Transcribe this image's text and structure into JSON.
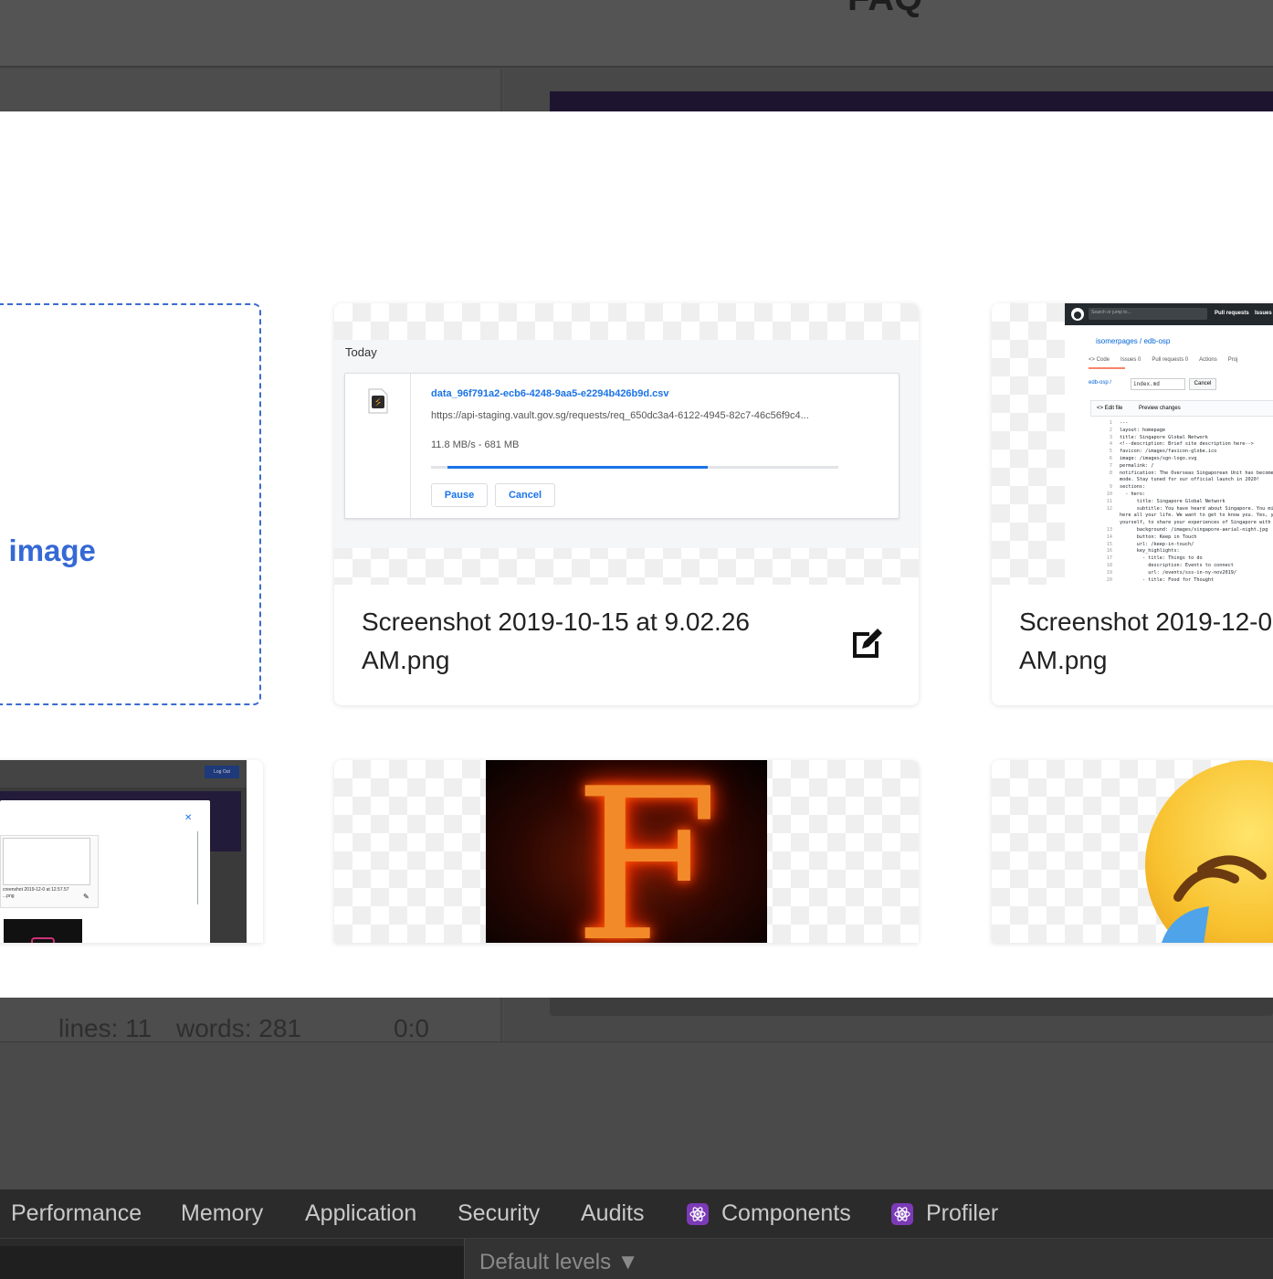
{
  "background_app": {
    "header_title": "FAQ",
    "status_bar": {
      "lines": "lines: 11",
      "words": "words: 281",
      "cursor": "0:0"
    }
  },
  "modal": {
    "upload": {
      "label": "v image"
    },
    "images": [
      {
        "filename": "Screenshot 2019-10-15 at 9.02.26 AM.png",
        "icon": "edit-icon",
        "preview": {
          "heading": "Today",
          "file_name": "data_96f791a2-ecb6-4248-9aa5-e2294b426b9d.csv",
          "url": "https://api-staging.vault.gov.sg/requests/req_650dc3a4-6122-4945-82c7-46c56f9c4...",
          "speed": "11.8 MB/s - 681 MB",
          "progress": 0.64,
          "pause_label": "Pause",
          "cancel_label": "Cancel"
        }
      },
      {
        "filename": "Screenshot 2019-12-0 AM.png",
        "preview": {
          "search_placeholder": "Search or jump to...",
          "top_links": [
            "Pull requests",
            "Issues"
          ],
          "repo": "isomerpages / edb-osp",
          "tabs": [
            "<> Code",
            "Issues 0",
            "Pull requests 0",
            "Actions",
            "Proj"
          ],
          "path_repo": "edb-osp /",
          "path_file": "index.md",
          "cancel_label": "Cancel",
          "edit_tabs": [
            "<> Edit file",
            "Preview changes"
          ],
          "code_lines": [
            {
              "n": "1",
              "t": "---"
            },
            {
              "n": "2",
              "t": "layout: homepage"
            },
            {
              "n": "3",
              "t": "title: Singapore Global Network"
            },
            {
              "n": "4",
              "t": "<!--description: Brief site description here-->"
            },
            {
              "n": "5",
              "t": "favicon: /images/favicon-globe.ico"
            },
            {
              "n": "6",
              "t": "image: /images/sgn-logo.svg"
            },
            {
              "n": "7",
              "t": "permalink: /"
            },
            {
              "n": "8",
              "t": "notification: The Overseas Singaporean Unit has become a"
            },
            {
              "n": "",
              "t": "mode. Stay tuned for our official launch in 2020!"
            },
            {
              "n": "9",
              "t": "sections:"
            },
            {
              "n": "10",
              "t": "  - hero:"
            },
            {
              "n": "11",
              "t": "      title: Singapore Global Network"
            },
            {
              "n": "12",
              "t": "      subtitle: You have heard about Singapore. You mi"
            },
            {
              "n": "",
              "t": "here all your life. We want to get to know you. Yes, you"
            },
            {
              "n": "",
              "t": "yourself, to share your experiences of Singapore with ea"
            },
            {
              "n": "13",
              "t": "      background: /images/singapore-aerial-night.jpg"
            },
            {
              "n": "14",
              "t": "      button: Keep in Touch"
            },
            {
              "n": "15",
              "t": "      url: /keep-in-touch/"
            },
            {
              "n": "16",
              "t": "      key_highlights:"
            },
            {
              "n": "17",
              "t": "        - title: Things to do"
            },
            {
              "n": "18",
              "t": "          description: Events to connect"
            },
            {
              "n": "19",
              "t": "          url: /events/sss-in-ny-nov2019/"
            },
            {
              "n": "20",
              "t": "        - title: Food for Thought"
            }
          ]
        }
      },
      {
        "nested_caption": "creenshot 2019-12-0 at 12.57.57 ...png",
        "nested_button": "Log Out"
      },
      {
        "letter": "F"
      },
      {
        "emoji": "laughing-crying-emoji"
      }
    ]
  },
  "devtools": {
    "tabs": [
      {
        "label": "Performance"
      },
      {
        "label": "Memory"
      },
      {
        "label": "Application"
      },
      {
        "label": "Security"
      },
      {
        "label": "Audits"
      },
      {
        "label": "Components",
        "icon": "react-icon"
      },
      {
        "label": "Profiler",
        "icon": "react-icon"
      }
    ],
    "levels_label": "Default levels ▼"
  },
  "colors": {
    "accent_blue": "#3469d6",
    "download_blue": "#1a73e8",
    "react_purple": "#7c3ab7"
  }
}
